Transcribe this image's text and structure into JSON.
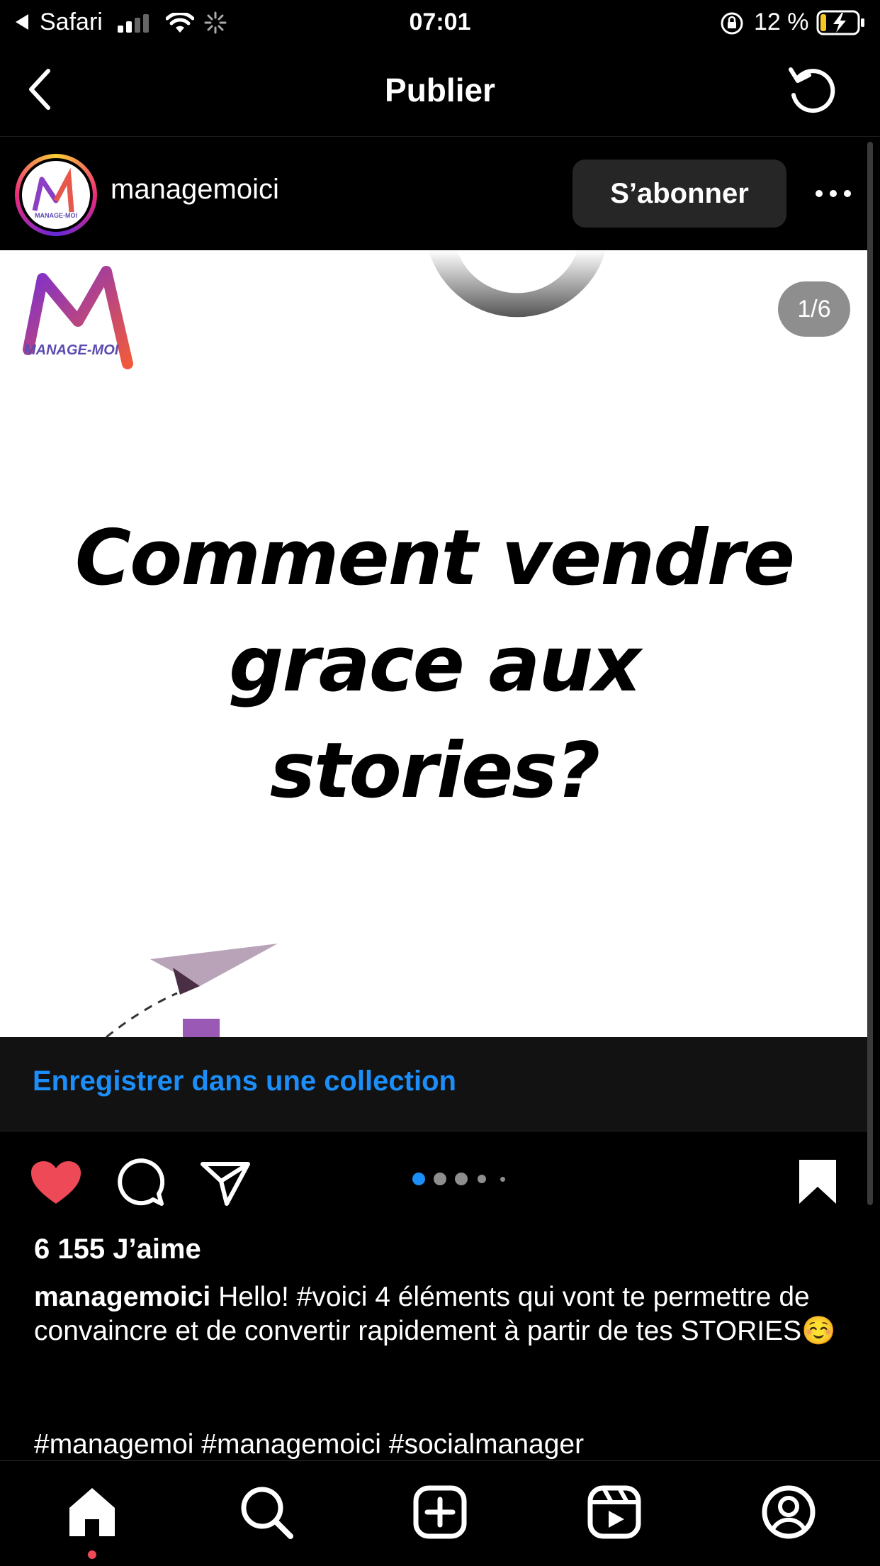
{
  "status_bar": {
    "back_app": "Safari",
    "time": "07:01",
    "battery": "12 %"
  },
  "nav": {
    "title": "Publier"
  },
  "post": {
    "username": "managemoici",
    "follow_label": "S’abonner",
    "image": {
      "counter": "1/6",
      "logo_text": "MANAGE-MOI",
      "headline_lines": [
        "Comment vendre",
        "grace aux",
        "stories?"
      ]
    },
    "carousel": {
      "current": 1,
      "total": 6
    },
    "collection_link": "Enregistrer dans une collection",
    "likes": "6 155 J’aime",
    "caption_user": "managemoici",
    "caption_text": " Hello! #voici 4 éléments qui vont te permettre de convaincre et de convertir rapidement à partir de tes STORIES☺️",
    "hashtags": "#managemoi #managemoici #socialmanager"
  },
  "tabbar": {
    "tabs": [
      "home-icon",
      "search-icon",
      "create-icon",
      "reels-icon",
      "profile-icon"
    ],
    "active": "home-icon"
  },
  "colors": {
    "accent_blue": "#1c8ef9",
    "like_red": "#ed4956",
    "background": "#000000"
  }
}
